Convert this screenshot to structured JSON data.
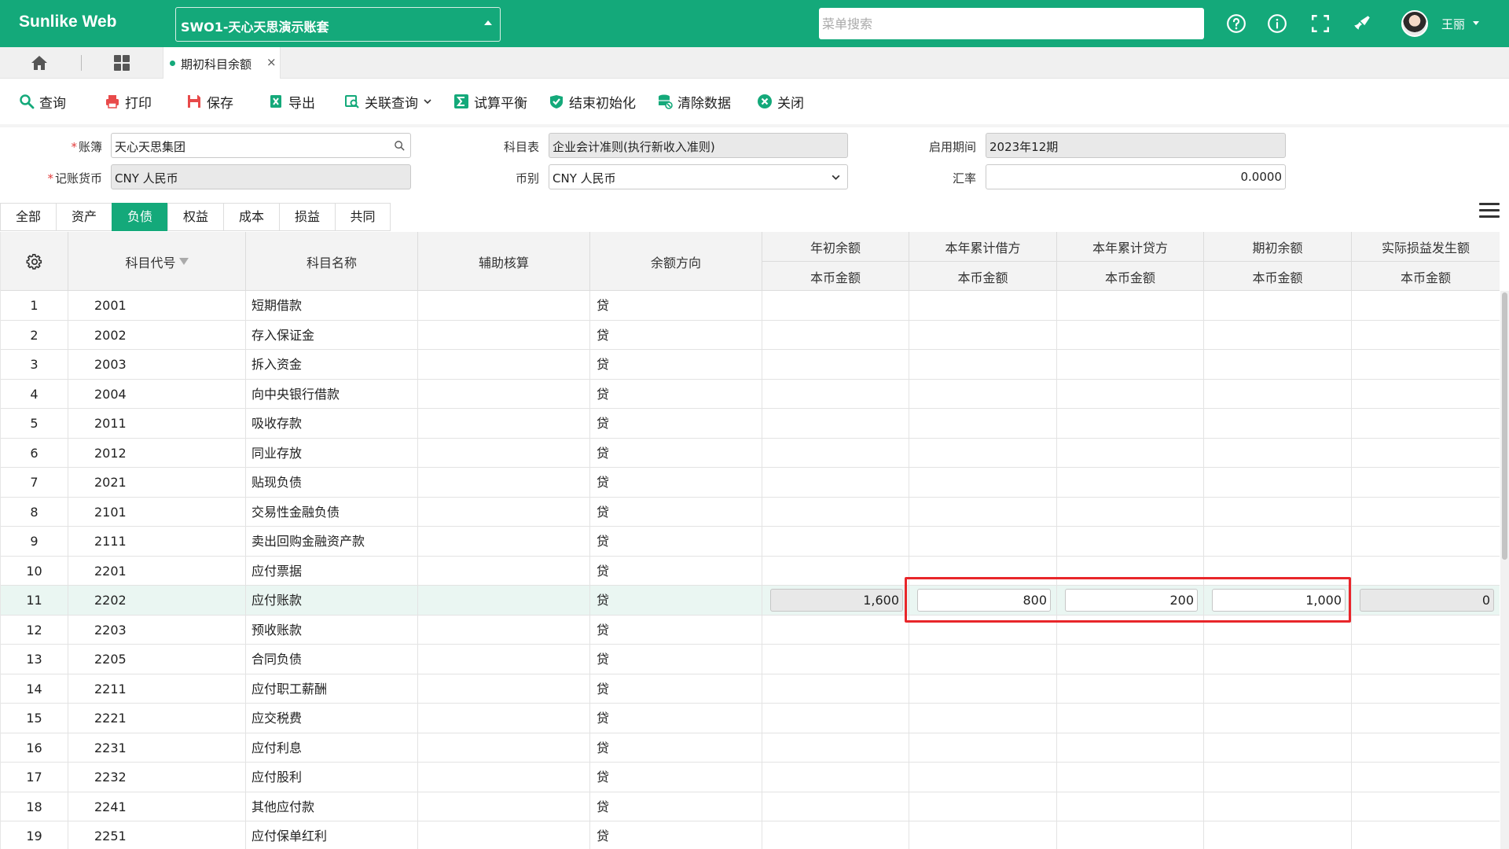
{
  "app": {
    "brand": "Sunlike Web",
    "account": "SWO1-天心天思演示账套"
  },
  "header": {
    "search_placeholder": "菜单搜索",
    "username": "王丽"
  },
  "tabs": {
    "active_tab": "期初科目余额",
    "close": "×"
  },
  "toolbar": {
    "query": "查询",
    "print": "打印",
    "save": "保存",
    "export": "导出",
    "related_query": "关联查询",
    "trial_balance": "试算平衡",
    "finish_init": "结束初始化",
    "clear_data": "清除数据",
    "close": "关闭"
  },
  "form": {
    "ledger_label": "账簿",
    "ledger_value": "天心天思集团",
    "chart_label": "科目表",
    "chart_value": "企业会计准则(执行新收入准则)",
    "period_label": "启用期间",
    "period_value": "2023年12期",
    "currency_label": "记账货币",
    "currency_value": "CNY 人民币",
    "coin_label": "币别",
    "coin_value": "CNY 人民币",
    "rate_label": "汇率",
    "rate_value": "0.0000"
  },
  "category_tabs": [
    "全部",
    "资产",
    "负债",
    "权益",
    "成本",
    "损益",
    "共同"
  ],
  "active_category": "负债",
  "grid": {
    "headers": {
      "code": "科目代号",
      "name": "科目名称",
      "aux": "辅助核算",
      "direction": "余额方向",
      "year_begin": "年初余额",
      "year_debit": "本年累计借方",
      "year_credit": "本年累计贷方",
      "period_begin": "期初余额",
      "actual_pl": "实际损益发生额",
      "sub_local": "本币金额"
    },
    "rows": [
      {
        "no": "1",
        "code": "2001",
        "name": "短期借款",
        "dir": "贷"
      },
      {
        "no": "2",
        "code": "2002",
        "name": "存入保证金",
        "dir": "贷"
      },
      {
        "no": "3",
        "code": "2003",
        "name": "拆入资金",
        "dir": "贷"
      },
      {
        "no": "4",
        "code": "2004",
        "name": "向中央银行借款",
        "dir": "贷"
      },
      {
        "no": "5",
        "code": "2011",
        "name": "吸收存款",
        "dir": "贷"
      },
      {
        "no": "6",
        "code": "2012",
        "name": "同业存放",
        "dir": "贷"
      },
      {
        "no": "7",
        "code": "2021",
        "name": "贴现负债",
        "dir": "贷"
      },
      {
        "no": "8",
        "code": "2101",
        "name": "交易性金融负债",
        "dir": "贷"
      },
      {
        "no": "9",
        "code": "2111",
        "name": "卖出回购金融资产款",
        "dir": "贷"
      },
      {
        "no": "10",
        "code": "2201",
        "name": "应付票据",
        "dir": "贷"
      },
      {
        "no": "11",
        "code": "2202",
        "name": "应付账款",
        "dir": "贷",
        "year_begin": "1,600",
        "year_debit": "800",
        "year_credit": "200",
        "period_begin": "1,000",
        "actual_pl": "0"
      },
      {
        "no": "12",
        "code": "2203",
        "name": "预收账款",
        "dir": "贷"
      },
      {
        "no": "13",
        "code": "2205",
        "name": "合同负债",
        "dir": "贷"
      },
      {
        "no": "14",
        "code": "2211",
        "name": "应付职工薪酬",
        "dir": "贷"
      },
      {
        "no": "15",
        "code": "2221",
        "name": "应交税费",
        "dir": "贷"
      },
      {
        "no": "16",
        "code": "2231",
        "name": "应付利息",
        "dir": "贷"
      },
      {
        "no": "17",
        "code": "2232",
        "name": "应付股利",
        "dir": "贷"
      },
      {
        "no": "18",
        "code": "2241",
        "name": "其他应付款",
        "dir": "贷"
      },
      {
        "no": "19",
        "code": "2251",
        "name": "应付保单红利",
        "dir": "贷"
      }
    ]
  }
}
